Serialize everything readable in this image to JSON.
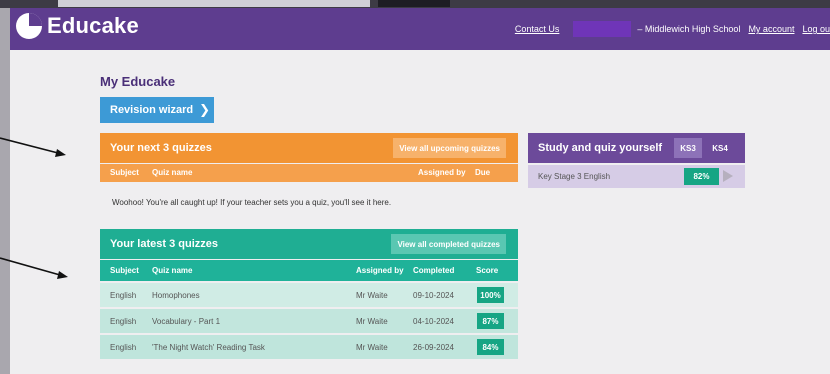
{
  "header": {
    "logo_text": "Educake",
    "contact_label": "Contact Us",
    "school_text": "– Middlewich High School",
    "my_account_label": "My account",
    "logout_label": "Log ou"
  },
  "page": {
    "title": "My Educake",
    "wizard_label": "Revision wizard"
  },
  "next_quizzes": {
    "title": "Your next 3 quizzes",
    "view_all_label": "View all upcoming quizzes",
    "columns": [
      "Subject",
      "Quiz name",
      "Assigned by",
      "Due"
    ],
    "empty_message": "Woohoo! You're all caught up! If your teacher sets you a quiz, you'll see it here."
  },
  "latest_quizzes": {
    "title": "Your latest 3 quizzes",
    "view_all_label": "View all completed quizzes",
    "columns": [
      "Subject",
      "Quiz name",
      "Assigned by",
      "Completed",
      "Score"
    ],
    "rows": [
      {
        "subject": "English",
        "quiz": "Homophones",
        "assigned_by": "Mr Waite",
        "completed": "09-10-2024",
        "score": "100%"
      },
      {
        "subject": "English",
        "quiz": "Vocabulary - Part 1",
        "assigned_by": "Mr Waite",
        "completed": "04-10-2024",
        "score": "87%"
      },
      {
        "subject": "English",
        "quiz": "'The Night Watch' Reading Task",
        "assigned_by": "Mr Waite",
        "completed": "26-09-2024",
        "score": "84%"
      }
    ]
  },
  "study": {
    "title": "Study and quiz yourself",
    "ks3_label": "KS3",
    "ks4_label": "KS4",
    "course_label": "Key Stage 3 English",
    "course_score": "82%"
  },
  "colors": {
    "header": "#5e3d8f",
    "orange": "#f29433",
    "teal": "#1fae93",
    "purple_panel": "#6c4a9a",
    "score_green": "#16a584"
  }
}
